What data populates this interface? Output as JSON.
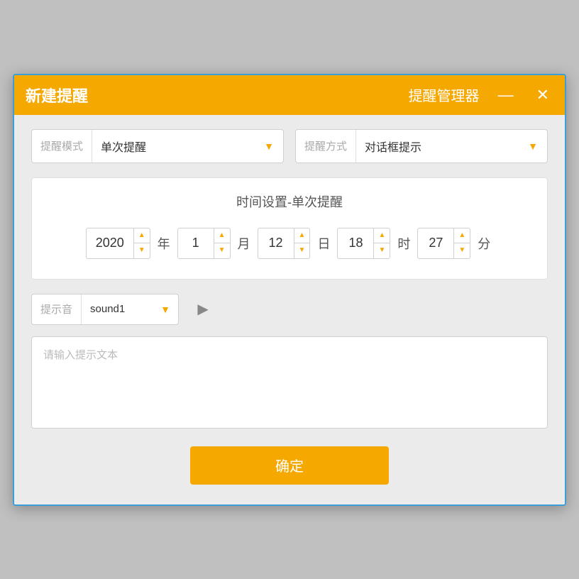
{
  "titlebar": {
    "title": "新建提醒",
    "app_name": "提醒管理器",
    "minimize_label": "—",
    "close_label": "✕"
  },
  "mode_dropdown": {
    "label": "提醒模式",
    "value": "单次提醒",
    "arrow": "▼"
  },
  "type_dropdown": {
    "label": "提醒方式",
    "value": "对话框提示",
    "arrow": "▼"
  },
  "time_section": {
    "title": "时间设置-单次提醒",
    "year": {
      "value": "2020",
      "unit": "年"
    },
    "month": {
      "value": "1",
      "unit": "月"
    },
    "day": {
      "value": "12",
      "unit": "日"
    },
    "hour": {
      "value": "18",
      "unit": "时"
    },
    "minute": {
      "value": "27",
      "unit": "分"
    }
  },
  "sound": {
    "label": "提示音",
    "value": "sound1",
    "arrow": "▼",
    "play_icon": "▶"
  },
  "text_input": {
    "placeholder": "请输入提示文本"
  },
  "confirm_btn": {
    "label": "确定"
  }
}
